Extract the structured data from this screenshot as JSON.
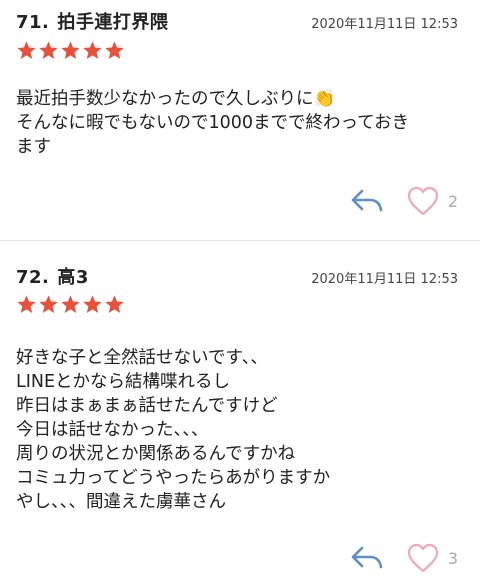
{
  "colors": {
    "star": "#e8503a",
    "reply_icon": "#5b8fc7",
    "heart_icon": "#f2a8ba",
    "count": "#aaaaaa"
  },
  "posts": [
    {
      "number": "71.",
      "name": "拍手連打界隈",
      "date": "2020年11月11日 12:53",
      "rating": 5,
      "body": "最近拍手数少なかったので久しぶりに👏\nそんなに暇でもないので1000までで終わっておき\nます",
      "like_count": "2"
    },
    {
      "number": "72.",
      "name": "高3",
      "date": "2020年11月11日 12:53",
      "rating": 5,
      "body": "好きな子と全然話せないです、、\nLINEとかなら結構喋れるし\n昨日はまぁまぁ話せたんですけど\n今日は話せなかった、、、\n周りの状況とか関係あるんですかね\nコミュ力ってどうやったらあがりますか\nやし、、、間違えた虜華さん",
      "like_count": "3"
    }
  ]
}
